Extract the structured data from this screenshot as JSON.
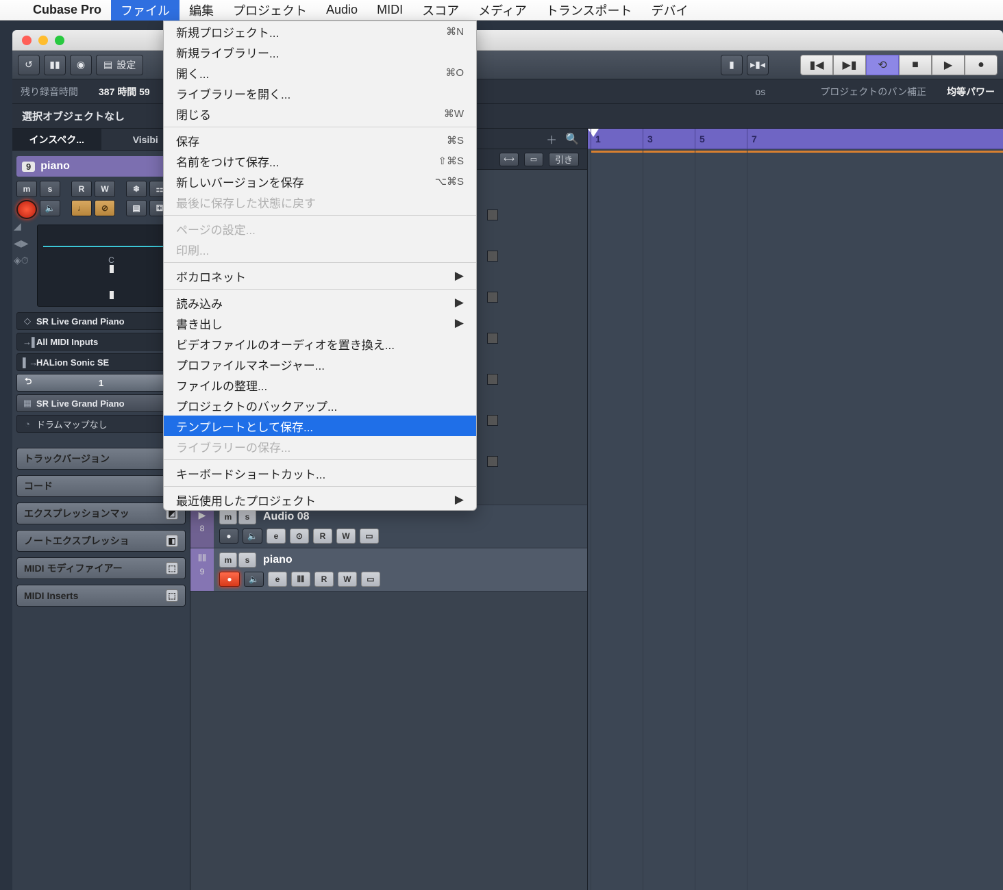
{
  "menubar": {
    "app": "Cubase Pro",
    "items": [
      "ファイル",
      "編集",
      "プロジェクト",
      "Audio",
      "MIDI",
      "スコア",
      "メディア",
      "トランスポート",
      "デバイ"
    ]
  },
  "file_menu": {
    "new_project": "新規プロジェクト...",
    "new_library": "新規ライブラリー...",
    "open": "開く...",
    "open_library": "ライブラリーを開く...",
    "close": "閉じる",
    "save": "保存",
    "save_as": "名前をつけて保存...",
    "save_new_version": "新しいバージョンを保存",
    "revert": "最後に保存した状態に戻す",
    "page_setup": "ページの設定...",
    "print": "印刷...",
    "vocalonet": "ボカロネット",
    "import": "読み込み",
    "export": "書き出し",
    "replace_video_audio": "ビデオファイルのオーディオを置き換え...",
    "profile_manager": "プロファイルマネージャー...",
    "cleanup": "ファイルの整理...",
    "backup_project": "プロジェクトのバックアップ...",
    "save_as_template": "テンプレートとして保存...",
    "save_library": "ライブラリーの保存...",
    "key_shortcuts": "キーボードショートカット...",
    "recent_projects": "最近使用したプロジェクト",
    "sc_new": "⌘N",
    "sc_open": "⌘O",
    "sc_close": "⌘W",
    "sc_save": "⌘S",
    "sc_save_as": "⇧⌘S",
    "sc_save_new": "⌥⌘S"
  },
  "toolbar": {
    "settings": "設定"
  },
  "infobar": {
    "rec_time_label": "残り録音時間",
    "rec_time_value": "387 時間 59",
    "bars_label": "os",
    "pan_label": "プロジェクトのパン補正",
    "pan_value": "均等パワー"
  },
  "selbar": {
    "text": "選択オブジェクトなし"
  },
  "inspector": {
    "tab_inspector": "インスペク...",
    "tab_visibility": "Visibi",
    "track_num": "9",
    "track_name": "piano",
    "buttons": {
      "m": "m",
      "s": "s",
      "r": "R",
      "w": "W"
    },
    "fader_c": "C",
    "routing": {
      "out": "SR Live Grand Piano",
      "in": "All MIDI Inputs",
      "inst": "HALion Sonic SE",
      "ch": "1",
      "prog": "SR Live Grand Piano",
      "drummap": "ドラムマップなし"
    },
    "sections": {
      "track_versions": "トラックバージョン",
      "chord": "コード",
      "expression_map": "エクスプレッションマッ",
      "note_expression": "ノートエクスプレッショ",
      "midi_modifier": "MIDI モディファイアー",
      "midi_inserts": "MIDI Inserts"
    }
  },
  "tracklist": {
    "pull": "引き",
    "tracks": [
      {
        "num": "8",
        "name": "Audio 08",
        "type": "audio"
      },
      {
        "num": "9",
        "name": "piano",
        "type": "midi"
      }
    ]
  },
  "ruler": {
    "marks": [
      "1",
      "3",
      "5",
      "7"
    ]
  }
}
